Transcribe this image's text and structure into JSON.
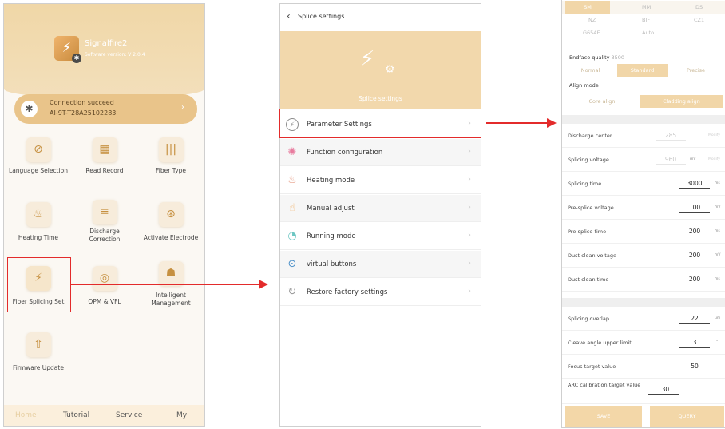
{
  "screen1": {
    "app_name": "Signalfire2",
    "version": "Software version: V 2.0.4",
    "logo_glyph": "⚡",
    "bt_glyph": "✱",
    "connection_status": "Connection succeed",
    "device_id": "AI-9T-T28A25102283",
    "grid": [
      {
        "label": "Language Selection",
        "icon": "globe-icon",
        "glyph": "⊘"
      },
      {
        "label": "Read Record",
        "icon": "record-icon",
        "glyph": "▦"
      },
      {
        "label": "Fiber Type",
        "icon": "fiber-type-icon",
        "glyph": "|||"
      },
      {
        "label": "Heating Time",
        "icon": "heating-icon",
        "glyph": "♨"
      },
      {
        "label": "Discharge Correction",
        "icon": "discharge-icon",
        "glyph": "≡"
      },
      {
        "label": "Activate Electrode",
        "icon": "electrode-icon",
        "glyph": "⊛"
      },
      {
        "label": "Fiber Splicing Set",
        "icon": "splice-settings-icon",
        "glyph": "⚡"
      },
      {
        "label": "OPM & VFL",
        "icon": "opm-icon",
        "glyph": "◎"
      },
      {
        "label": "Intelligent Management",
        "icon": "management-icon",
        "glyph": "☗"
      },
      {
        "label": "Firmware Update",
        "icon": "firmware-update-icon",
        "glyph": "⇧"
      }
    ],
    "nav": [
      "Home",
      "Tutorial",
      "Service",
      "My"
    ]
  },
  "screen2": {
    "title": "Splice settings",
    "hero_label": "Splice settings",
    "menu": [
      {
        "label": "Parameter Settings",
        "icon": "parameter-icon",
        "glyph": "⚡",
        "color": "#8c8c8c"
      },
      {
        "label": "Function configuration",
        "icon": "function-config-icon",
        "glyph": "✺",
        "color": "#e87b9e"
      },
      {
        "label": "Heating mode",
        "icon": "heating-mode-icon",
        "glyph": "♨",
        "color": "#e7a08a"
      },
      {
        "label": "Manual adjust",
        "icon": "manual-adjust-icon",
        "glyph": "☝",
        "color": "#f2b774"
      },
      {
        "label": "Running mode",
        "icon": "running-mode-icon",
        "glyph": "◔",
        "color": "#6cc6c2"
      },
      {
        "label": "virtual buttons",
        "icon": "virtual-buttons-icon",
        "glyph": "⊙",
        "color": "#4a8fc8"
      },
      {
        "label": "Restore factory settings",
        "icon": "restore-icon",
        "glyph": "↻",
        "color": "#9a9a9a"
      }
    ]
  },
  "screen3": {
    "fiber_types": [
      "SM",
      "MM",
      "DS",
      "NZ",
      "BIF",
      "CZ1",
      "G654E",
      "Auto"
    ],
    "endface_label": "Endface quality",
    "endface_value": "3500",
    "quality_options": [
      "Normal",
      "Standard",
      "Precise"
    ],
    "align_label": "Align mode",
    "align_options": [
      "Core align",
      "Cladding align"
    ],
    "params": [
      {
        "label": "Discharge center",
        "value": "285",
        "unit": "",
        "modify": "Modify",
        "faint": true
      },
      {
        "label": "Splicing voltage",
        "value": "960",
        "unit": "mV",
        "modify": "Modify",
        "faint": true
      },
      {
        "label": "Splicing time",
        "value": "3000",
        "unit": "ms"
      },
      {
        "label": "Pre-splice voltage",
        "value": "100",
        "unit": "mV"
      },
      {
        "label": "Pre-splice time",
        "value": "200",
        "unit": "ms"
      },
      {
        "label": "Dust clean voltage",
        "value": "200",
        "unit": "mV"
      },
      {
        "label": "Dust clean time",
        "value": "200",
        "unit": "ms"
      }
    ],
    "params2": [
      {
        "label": "Splicing overlap",
        "value": "22",
        "unit": "um"
      },
      {
        "label": "Cleave angle upper limit",
        "value": "3",
        "unit": "°"
      },
      {
        "label": "Focus target value",
        "value": "50",
        "unit": ""
      }
    ],
    "arc_label": "ARC calibration target value",
    "arc_value": "130",
    "save_label": "SAVE",
    "query_label": "QUERY"
  }
}
